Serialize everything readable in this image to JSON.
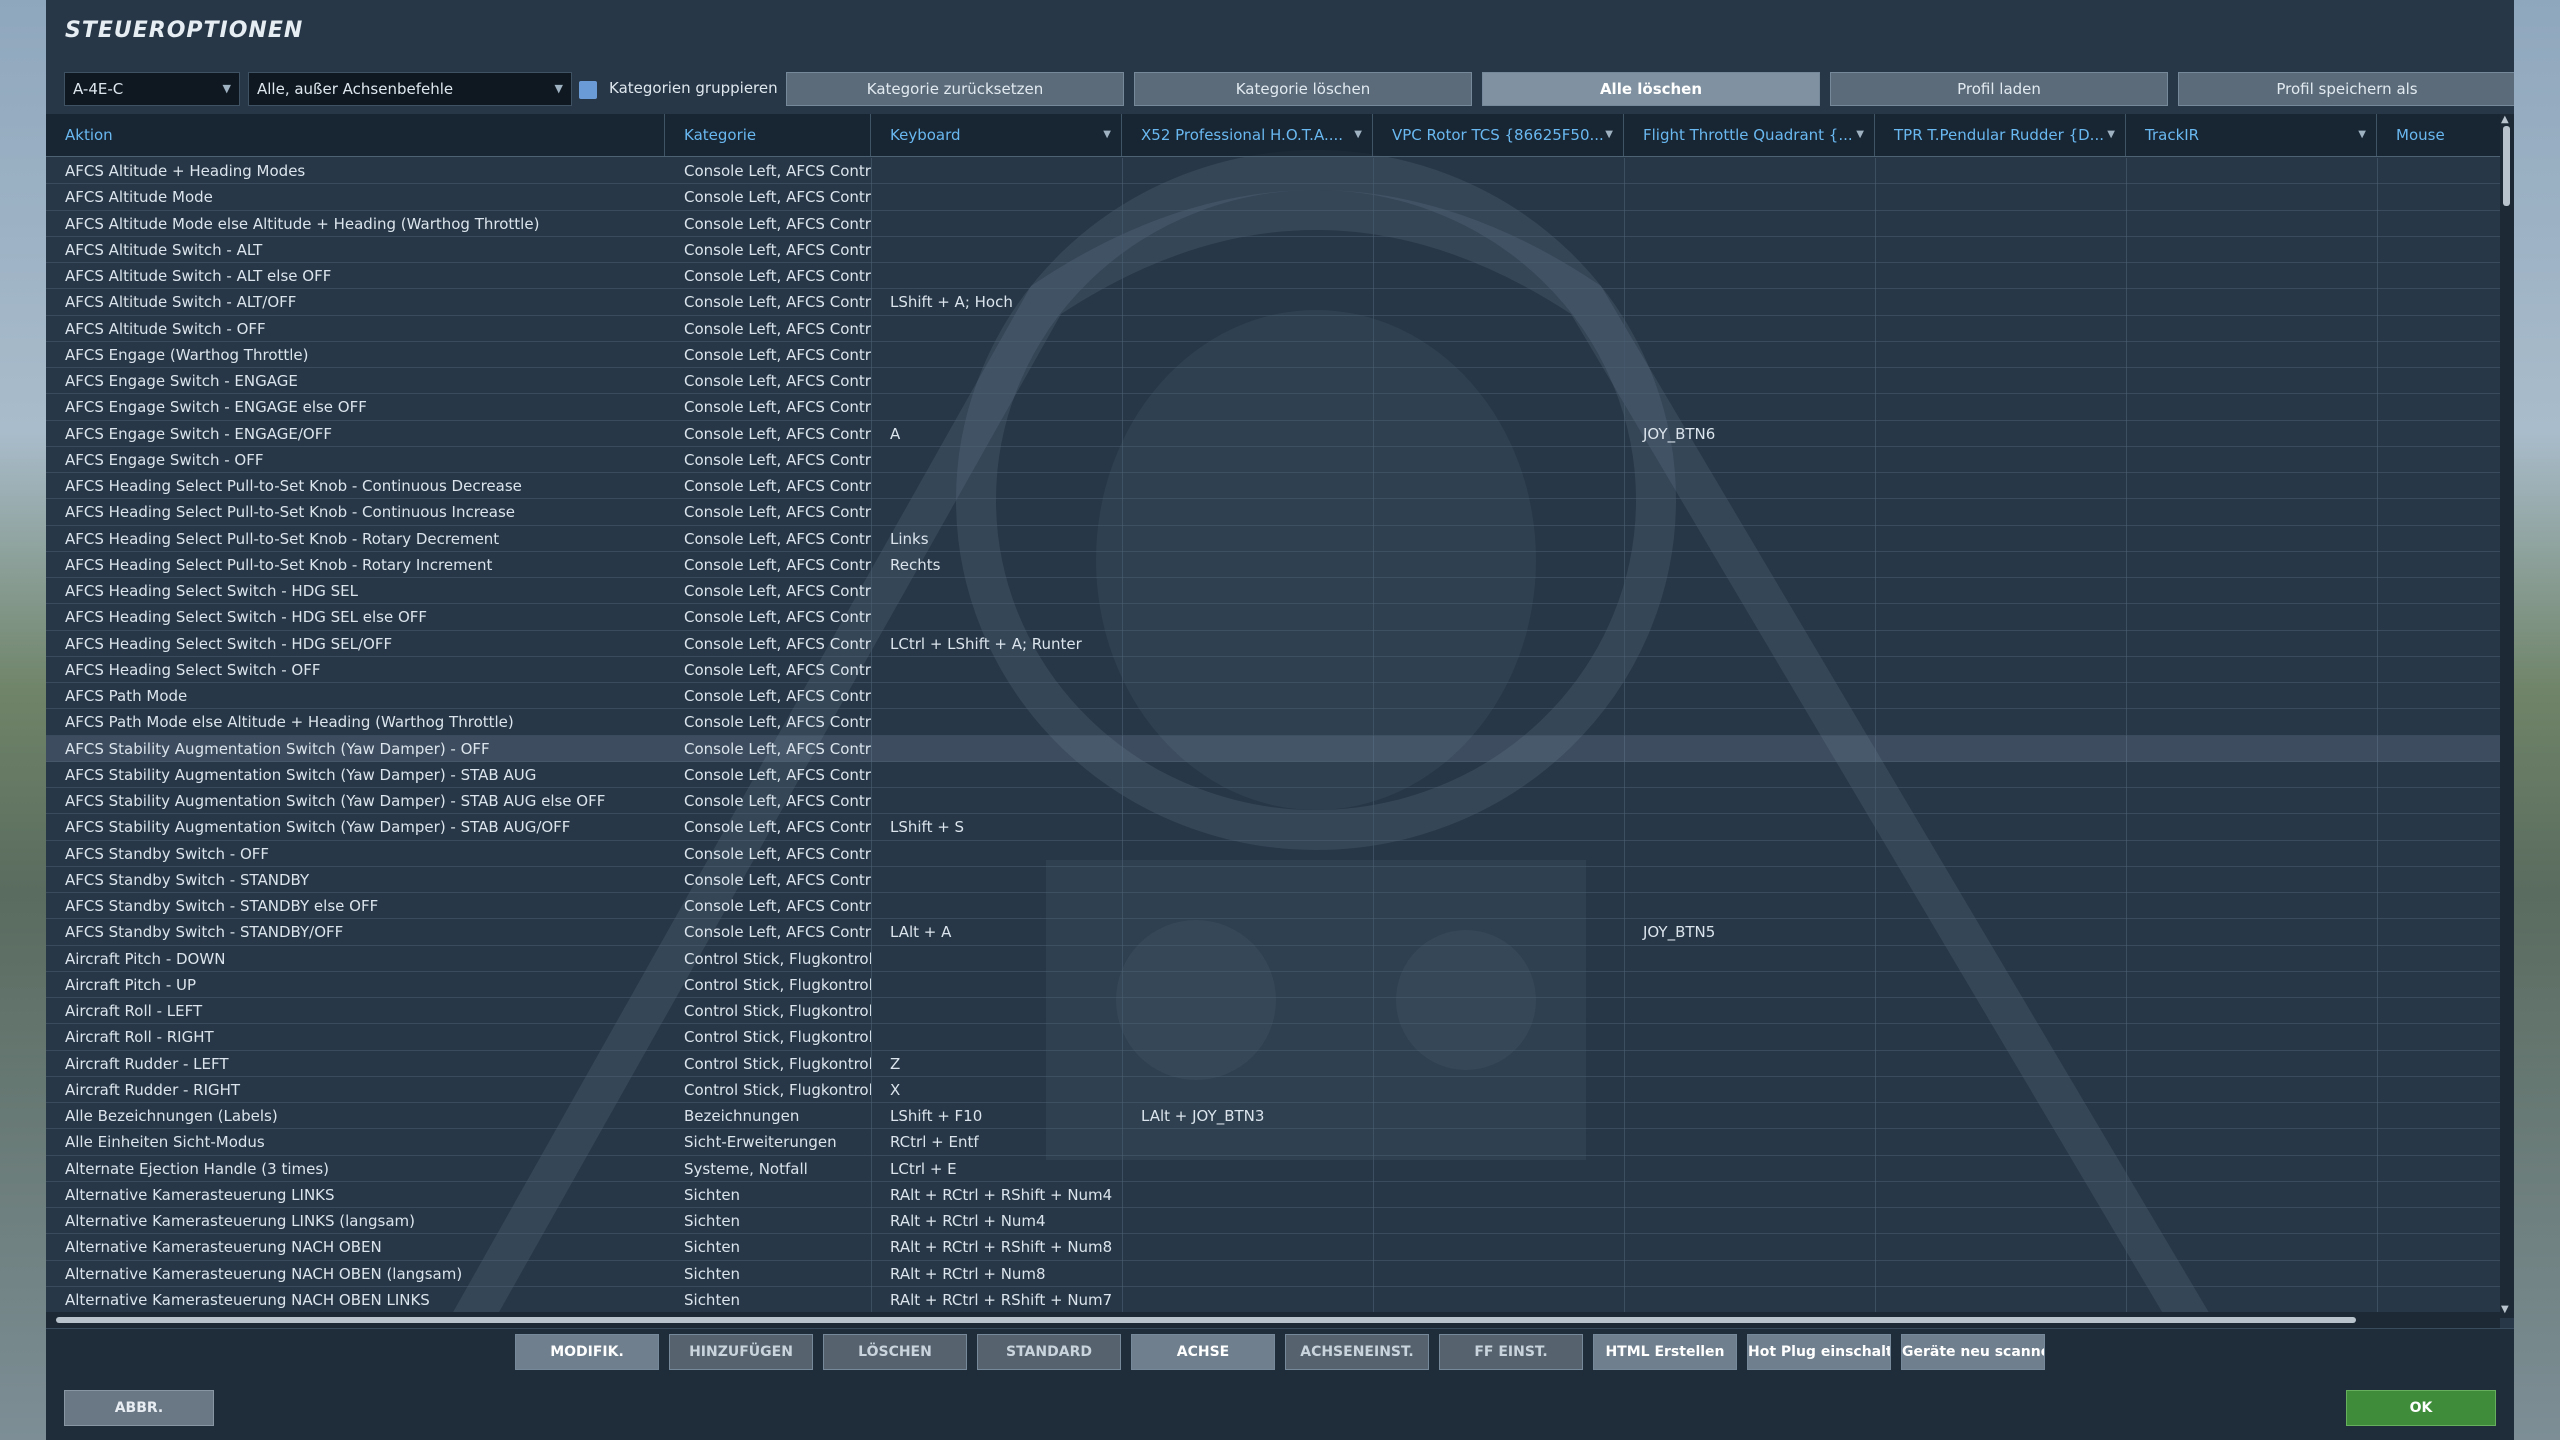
{
  "title": "STEUEROPTIONEN",
  "filters": {
    "aircraft": "A-4E-C",
    "category_filter": "Alle, außer Achsenbefehle",
    "group_checkbox_label": "Kategorien gruppieren",
    "group_checkbox_checked": true
  },
  "top_buttons": [
    {
      "label": "Kategorie zurücksetzen",
      "active": false
    },
    {
      "label": "Kategorie löschen",
      "active": false
    },
    {
      "label": "Alle löschen",
      "active": true
    },
    {
      "label": "Profil laden",
      "active": false
    },
    {
      "label": "Profil speichern als",
      "active": false
    }
  ],
  "columns": [
    {
      "label": "Aktion",
      "sortable": false
    },
    {
      "label": "Kategorie",
      "sortable": false
    },
    {
      "label": "Keyboard",
      "sortable": true
    },
    {
      "label": "X52 Professional H.O.T.A....",
      "sortable": true
    },
    {
      "label": "VPC Rotor TCS {86625F50...",
      "sortable": true
    },
    {
      "label": "Flight Throttle Quadrant {...",
      "sortable": true
    },
    {
      "label": "TPR T.Pendular Rudder {D...",
      "sortable": true
    },
    {
      "label": "TrackIR",
      "sortable": true
    },
    {
      "label": "Mouse",
      "sortable": false
    }
  ],
  "rows": [
    {
      "action": "AFCS Altitude + Heading Modes",
      "category": "Console Left, AFCS Control",
      "keyboard": "",
      "x52": "",
      "vpc": "",
      "ftq": "",
      "tpr": "",
      "trackir": "",
      "mouse": ""
    },
    {
      "action": "AFCS Altitude Mode",
      "category": "Console Left, AFCS Control",
      "keyboard": "",
      "x52": "",
      "vpc": "",
      "ftq": "",
      "tpr": "",
      "trackir": "",
      "mouse": ""
    },
    {
      "action": "AFCS Altitude Mode else Altitude + Heading (Warthog Throttle)",
      "category": "Console Left, AFCS Control",
      "keyboard": "",
      "x52": "",
      "vpc": "",
      "ftq": "",
      "tpr": "",
      "trackir": "",
      "mouse": ""
    },
    {
      "action": "AFCS Altitude Switch - ALT",
      "category": "Console Left, AFCS Control",
      "keyboard": "",
      "x52": "",
      "vpc": "",
      "ftq": "",
      "tpr": "",
      "trackir": "",
      "mouse": ""
    },
    {
      "action": "AFCS Altitude Switch - ALT else OFF",
      "category": "Console Left, AFCS Control",
      "keyboard": "",
      "x52": "",
      "vpc": "",
      "ftq": "",
      "tpr": "",
      "trackir": "",
      "mouse": ""
    },
    {
      "action": "AFCS Altitude Switch - ALT/OFF",
      "category": "Console Left, AFCS Control",
      "keyboard": "LShift + A; Hoch",
      "x52": "",
      "vpc": "",
      "ftq": "",
      "tpr": "",
      "trackir": "",
      "mouse": ""
    },
    {
      "action": "AFCS Altitude Switch - OFF",
      "category": "Console Left, AFCS Control",
      "keyboard": "",
      "x52": "",
      "vpc": "",
      "ftq": "",
      "tpr": "",
      "trackir": "",
      "mouse": ""
    },
    {
      "action": "AFCS Engage (Warthog Throttle)",
      "category": "Console Left, AFCS Control",
      "keyboard": "",
      "x52": "",
      "vpc": "",
      "ftq": "",
      "tpr": "",
      "trackir": "",
      "mouse": ""
    },
    {
      "action": "AFCS Engage Switch - ENGAGE",
      "category": "Console Left, AFCS Control",
      "keyboard": "",
      "x52": "",
      "vpc": "",
      "ftq": "",
      "tpr": "",
      "trackir": "",
      "mouse": ""
    },
    {
      "action": "AFCS Engage Switch - ENGAGE else OFF",
      "category": "Console Left, AFCS Control",
      "keyboard": "",
      "x52": "",
      "vpc": "",
      "ftq": "",
      "tpr": "",
      "trackir": "",
      "mouse": ""
    },
    {
      "action": "AFCS Engage Switch - ENGAGE/OFF",
      "category": "Console Left, AFCS Control",
      "keyboard": "A",
      "x52": "",
      "vpc": "",
      "ftq": "JOY_BTN6",
      "tpr": "",
      "trackir": "",
      "mouse": ""
    },
    {
      "action": "AFCS Engage Switch - OFF",
      "category": "Console Left, AFCS Control",
      "keyboard": "",
      "x52": "",
      "vpc": "",
      "ftq": "",
      "tpr": "",
      "trackir": "",
      "mouse": ""
    },
    {
      "action": "AFCS Heading Select Pull-to-Set Knob - Continuous Decrease",
      "category": "Console Left, AFCS Control",
      "keyboard": "",
      "x52": "",
      "vpc": "",
      "ftq": "",
      "tpr": "",
      "trackir": "",
      "mouse": ""
    },
    {
      "action": "AFCS Heading Select Pull-to-Set Knob - Continuous Increase",
      "category": "Console Left, AFCS Control",
      "keyboard": "",
      "x52": "",
      "vpc": "",
      "ftq": "",
      "tpr": "",
      "trackir": "",
      "mouse": ""
    },
    {
      "action": "AFCS Heading Select Pull-to-Set Knob - Rotary Decrement",
      "category": "Console Left, AFCS Control",
      "keyboard": "Links",
      "x52": "",
      "vpc": "",
      "ftq": "",
      "tpr": "",
      "trackir": "",
      "mouse": ""
    },
    {
      "action": "AFCS Heading Select Pull-to-Set Knob - Rotary Increment",
      "category": "Console Left, AFCS Control",
      "keyboard": "Rechts",
      "x52": "",
      "vpc": "",
      "ftq": "",
      "tpr": "",
      "trackir": "",
      "mouse": ""
    },
    {
      "action": "AFCS Heading Select Switch - HDG SEL",
      "category": "Console Left, AFCS Control",
      "keyboard": "",
      "x52": "",
      "vpc": "",
      "ftq": "",
      "tpr": "",
      "trackir": "",
      "mouse": ""
    },
    {
      "action": "AFCS Heading Select Switch - HDG SEL else OFF",
      "category": "Console Left, AFCS Control",
      "keyboard": "",
      "x52": "",
      "vpc": "",
      "ftq": "",
      "tpr": "",
      "trackir": "",
      "mouse": ""
    },
    {
      "action": "AFCS Heading Select Switch - HDG SEL/OFF",
      "category": "Console Left, AFCS Control",
      "keyboard": "LCtrl + LShift + A; Runter",
      "x52": "",
      "vpc": "",
      "ftq": "",
      "tpr": "",
      "trackir": "",
      "mouse": ""
    },
    {
      "action": "AFCS Heading Select Switch - OFF",
      "category": "Console Left, AFCS Control",
      "keyboard": "",
      "x52": "",
      "vpc": "",
      "ftq": "",
      "tpr": "",
      "trackir": "",
      "mouse": ""
    },
    {
      "action": "AFCS Path Mode",
      "category": "Console Left, AFCS Control",
      "keyboard": "",
      "x52": "",
      "vpc": "",
      "ftq": "",
      "tpr": "",
      "trackir": "",
      "mouse": ""
    },
    {
      "action": "AFCS Path Mode else Altitude + Heading (Warthog Throttle)",
      "category": "Console Left, AFCS Control",
      "keyboard": "",
      "x52": "",
      "vpc": "",
      "ftq": "",
      "tpr": "",
      "trackir": "",
      "mouse": ""
    },
    {
      "action": "AFCS Stability Augmentation Switch (Yaw Damper) - OFF",
      "category": "Console Left, AFCS Control",
      "keyboard": "",
      "x52": "",
      "vpc": "",
      "ftq": "",
      "tpr": "",
      "trackir": "",
      "mouse": "",
      "highlight": true
    },
    {
      "action": "AFCS Stability Augmentation Switch (Yaw Damper) - STAB AUG",
      "category": "Console Left, AFCS Control",
      "keyboard": "",
      "x52": "",
      "vpc": "",
      "ftq": "",
      "tpr": "",
      "trackir": "",
      "mouse": ""
    },
    {
      "action": "AFCS Stability Augmentation Switch (Yaw Damper) - STAB AUG else OFF",
      "category": "Console Left, AFCS Control",
      "keyboard": "",
      "x52": "",
      "vpc": "",
      "ftq": "",
      "tpr": "",
      "trackir": "",
      "mouse": ""
    },
    {
      "action": "AFCS Stability Augmentation Switch (Yaw Damper) - STAB AUG/OFF",
      "category": "Console Left, AFCS Control",
      "keyboard": "LShift + S",
      "x52": "",
      "vpc": "",
      "ftq": "",
      "tpr": "",
      "trackir": "",
      "mouse": ""
    },
    {
      "action": "AFCS Standby Switch - OFF",
      "category": "Console Left, AFCS Control",
      "keyboard": "",
      "x52": "",
      "vpc": "",
      "ftq": "",
      "tpr": "",
      "trackir": "",
      "mouse": ""
    },
    {
      "action": "AFCS Standby Switch - STANDBY",
      "category": "Console Left, AFCS Control",
      "keyboard": "",
      "x52": "",
      "vpc": "",
      "ftq": "",
      "tpr": "",
      "trackir": "",
      "mouse": ""
    },
    {
      "action": "AFCS Standby Switch - STANDBY else OFF",
      "category": "Console Left, AFCS Control",
      "keyboard": "",
      "x52": "",
      "vpc": "",
      "ftq": "",
      "tpr": "",
      "trackir": "",
      "mouse": ""
    },
    {
      "action": "AFCS Standby Switch - STANDBY/OFF",
      "category": "Console Left, AFCS Control",
      "keyboard": "LAlt + A",
      "x52": "",
      "vpc": "",
      "ftq": "JOY_BTN5",
      "tpr": "",
      "trackir": "",
      "mouse": ""
    },
    {
      "action": "Aircraft Pitch - DOWN",
      "category": "Control Stick, Flugkontrolle",
      "keyboard": "",
      "x52": "",
      "vpc": "",
      "ftq": "",
      "tpr": "",
      "trackir": "",
      "mouse": ""
    },
    {
      "action": "Aircraft Pitch - UP",
      "category": "Control Stick, Flugkontrolle",
      "keyboard": "",
      "x52": "",
      "vpc": "",
      "ftq": "",
      "tpr": "",
      "trackir": "",
      "mouse": ""
    },
    {
      "action": "Aircraft Roll - LEFT",
      "category": "Control Stick, Flugkontrolle",
      "keyboard": "",
      "x52": "",
      "vpc": "",
      "ftq": "",
      "tpr": "",
      "trackir": "",
      "mouse": ""
    },
    {
      "action": "Aircraft Roll - RIGHT",
      "category": "Control Stick, Flugkontrolle",
      "keyboard": "",
      "x52": "",
      "vpc": "",
      "ftq": "",
      "tpr": "",
      "trackir": "",
      "mouse": ""
    },
    {
      "action": "Aircraft Rudder - LEFT",
      "category": "Control Stick, Flugkontrolle",
      "keyboard": "Z",
      "x52": "",
      "vpc": "",
      "ftq": "",
      "tpr": "",
      "trackir": "",
      "mouse": ""
    },
    {
      "action": "Aircraft Rudder - RIGHT",
      "category": "Control Stick, Flugkontrolle",
      "keyboard": "X",
      "x52": "",
      "vpc": "",
      "ftq": "",
      "tpr": "",
      "trackir": "",
      "mouse": ""
    },
    {
      "action": "Alle Bezeichnungen (Labels)",
      "category": "Bezeichnungen",
      "keyboard": "LShift + F10",
      "x52": "LAlt + JOY_BTN3",
      "vpc": "",
      "ftq": "",
      "tpr": "",
      "trackir": "",
      "mouse": ""
    },
    {
      "action": "Alle Einheiten Sicht-Modus",
      "category": "Sicht-Erweiterungen",
      "keyboard": "RCtrl + Entf",
      "x52": "",
      "vpc": "",
      "ftq": "",
      "tpr": "",
      "trackir": "",
      "mouse": ""
    },
    {
      "action": "Alternate Ejection Handle (3 times)",
      "category": "Systeme, Notfall",
      "keyboard": "LCtrl + E",
      "x52": "",
      "vpc": "",
      "ftq": "",
      "tpr": "",
      "trackir": "",
      "mouse": ""
    },
    {
      "action": "Alternative Kamerasteuerung LINKS",
      "category": "Sichten",
      "keyboard": "RAlt + RCtrl + RShift + Num4",
      "x52": "",
      "vpc": "",
      "ftq": "",
      "tpr": "",
      "trackir": "",
      "mouse": ""
    },
    {
      "action": "Alternative Kamerasteuerung LINKS (langsam)",
      "category": "Sichten",
      "keyboard": "RAlt + RCtrl + Num4",
      "x52": "",
      "vpc": "",
      "ftq": "",
      "tpr": "",
      "trackir": "",
      "mouse": ""
    },
    {
      "action": "Alternative Kamerasteuerung NACH OBEN",
      "category": "Sichten",
      "keyboard": "RAlt + RCtrl + RShift + Num8",
      "x52": "",
      "vpc": "",
      "ftq": "",
      "tpr": "",
      "trackir": "",
      "mouse": ""
    },
    {
      "action": "Alternative Kamerasteuerung NACH OBEN (langsam)",
      "category": "Sichten",
      "keyboard": "RAlt + RCtrl + Num8",
      "x52": "",
      "vpc": "",
      "ftq": "",
      "tpr": "",
      "trackir": "",
      "mouse": ""
    },
    {
      "action": "Alternative Kamerasteuerung NACH OBEN LINKS",
      "category": "Sichten",
      "keyboard": "RAlt + RCtrl + RShift + Num7",
      "x52": "",
      "vpc": "",
      "ftq": "",
      "tpr": "",
      "trackir": "",
      "mouse": ""
    }
  ],
  "bottom_buttons": [
    {
      "label": "MODIFIK.",
      "bright": true
    },
    {
      "label": "HINZUFÜGEN",
      "bright": false
    },
    {
      "label": "LÖSCHEN",
      "bright": false
    },
    {
      "label": "STANDARD",
      "bright": false
    },
    {
      "label": "ACHSE",
      "bright": true
    },
    {
      "label": "ACHSENEINST.",
      "bright": false
    },
    {
      "label": "FF EINST.",
      "bright": false
    },
    {
      "label": "HTML Erstellen",
      "bright": true
    },
    {
      "label": "Hot Plug einschalten",
      "bright": true
    },
    {
      "label": "Geräte neu scannen",
      "bright": true
    }
  ],
  "cancel_label": "ABBR.",
  "ok_label": "OK",
  "colors": {
    "accent_header": "#69b8f0",
    "ok_green": "#3f8c3a",
    "checkbox_blue": "#6b9bd6"
  }
}
